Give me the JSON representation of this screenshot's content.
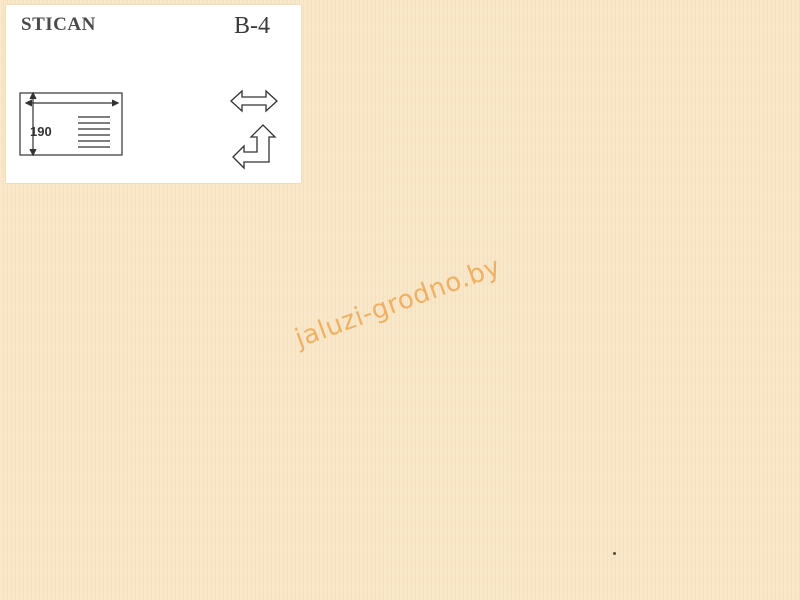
{
  "sample": {
    "brand": "STICAN",
    "code": "B-4",
    "max_width": "190",
    "watermark": "jaluzi-grodno.by"
  },
  "colors": {
    "fabric": "#f8e6c6",
    "label_background": "#ffffff",
    "watermark": "#eca248"
  },
  "icons": {
    "width_diagram": "roll-width-diagram-icon",
    "reversible": "double-arrow-icon",
    "turn": "turn-arrow-icon"
  }
}
